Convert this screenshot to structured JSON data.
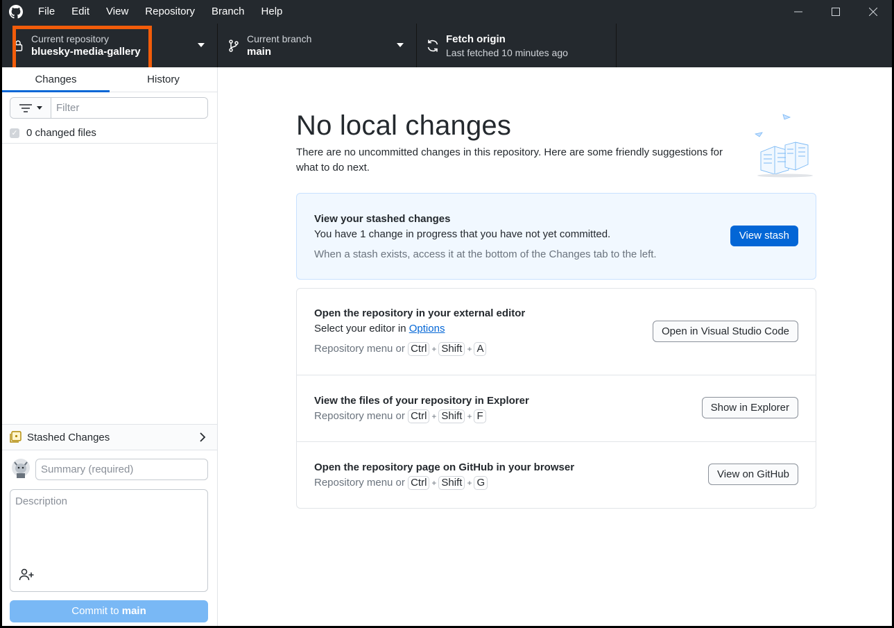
{
  "menu": {
    "items": [
      "File",
      "Edit",
      "View",
      "Repository",
      "Branch",
      "Help"
    ]
  },
  "toolbar": {
    "repo": {
      "label": "Current repository",
      "value": "bluesky-media-gallery"
    },
    "branch": {
      "label": "Current branch",
      "value": "main"
    },
    "fetch": {
      "label": "Fetch origin",
      "value": "Last fetched 10 minutes ago"
    }
  },
  "sidebar": {
    "tabs": [
      {
        "label": "Changes",
        "active": true
      },
      {
        "label": "History",
        "active": false
      }
    ],
    "filter_placeholder": "Filter",
    "changed_files": "0 changed files",
    "stashed_label": "Stashed Changes",
    "summary_placeholder": "Summary (required)",
    "description_placeholder": "Description",
    "commit_prefix": "Commit to ",
    "commit_branch": "main"
  },
  "main": {
    "title": "No local changes",
    "subtitle": "There are no uncommitted changes in this repository. Here are some friendly suggestions for what to do next.",
    "stash": {
      "title": "View your stashed changes",
      "text": "You have 1 change in progress that you have not yet committed.",
      "hint": "When a stash exists, access it at the bottom of the Changes tab to the left.",
      "button": "View stash"
    },
    "editor": {
      "title": "Open the repository in your external editor",
      "text_prefix": "Select your editor in ",
      "text_link": "Options",
      "hint_prefix": "Repository menu or",
      "keys": [
        "Ctrl",
        "Shift",
        "A"
      ],
      "button": "Open in Visual Studio Code"
    },
    "explorer": {
      "title": "View the files of your repository in Explorer",
      "hint_prefix": "Repository menu or",
      "keys": [
        "Ctrl",
        "Shift",
        "F"
      ],
      "button": "Show in Explorer"
    },
    "github": {
      "title": "Open the repository page on GitHub in your browser",
      "hint_prefix": "Repository menu or",
      "keys": [
        "Ctrl",
        "Shift",
        "G"
      ],
      "button": "View on GitHub"
    }
  },
  "colors": {
    "toolbar_bg": "#24292e",
    "accent": "#0366d6",
    "highlight": "#f25c0a",
    "commit_button": "#79b8f5"
  }
}
